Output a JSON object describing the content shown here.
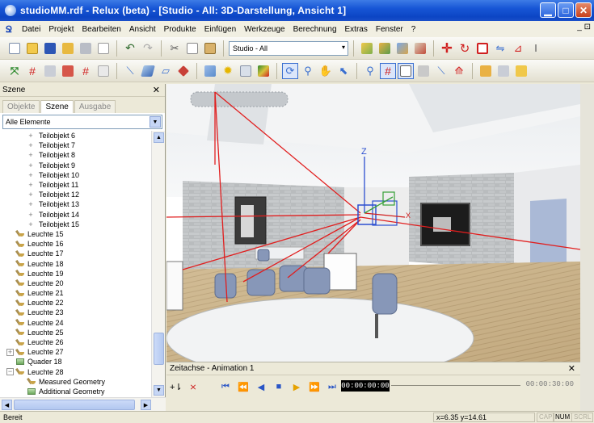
{
  "window": {
    "title": "studioMM.rdf - Relux (beta) - [Studio - All: 3D-Darstellung, Ansicht 1]",
    "buttons": [
      "minimize",
      "maximize",
      "close"
    ]
  },
  "menu": {
    "items": [
      "Datei",
      "Projekt",
      "Bearbeiten",
      "Ansicht",
      "Produkte",
      "Einfügen",
      "Werkzeuge",
      "Berechnung",
      "Extras",
      "Fenster",
      "?"
    ],
    "right": "_ ⊡"
  },
  "toolbar": {
    "combo_value": "Studio - All"
  },
  "scene_panel": {
    "title": "Szene",
    "tabs": [
      "Objekte",
      "Szene",
      "Ausgabe"
    ],
    "active_tab": "Szene",
    "filter_value": "Alle Elemente",
    "tree": [
      {
        "label": "Teilobjekt 6",
        "kind": "sub"
      },
      {
        "label": "Teilobjekt 7",
        "kind": "sub"
      },
      {
        "label": "Teilobjekt 8",
        "kind": "sub"
      },
      {
        "label": "Teilobjekt 9",
        "kind": "sub"
      },
      {
        "label": "Teilobjekt 10",
        "kind": "sub"
      },
      {
        "label": "Teilobjekt 11",
        "kind": "sub"
      },
      {
        "label": "Teilobjekt 12",
        "kind": "sub"
      },
      {
        "label": "Teilobjekt 13",
        "kind": "sub"
      },
      {
        "label": "Teilobjekt 14",
        "kind": "sub"
      },
      {
        "label": "Teilobjekt 15",
        "kind": "sub"
      },
      {
        "label": "Leuchte 15",
        "kind": "lamp"
      },
      {
        "label": "Leuchte 16",
        "kind": "lamp"
      },
      {
        "label": "Leuchte 17",
        "kind": "lamp"
      },
      {
        "label": "Leuchte 18",
        "kind": "lamp"
      },
      {
        "label": "Leuchte 19",
        "kind": "lamp"
      },
      {
        "label": "Leuchte 20",
        "kind": "lamp"
      },
      {
        "label": "Leuchte 21",
        "kind": "lamp"
      },
      {
        "label": "Leuchte 22",
        "kind": "lamp"
      },
      {
        "label": "Leuchte 23",
        "kind": "lamp"
      },
      {
        "label": "Leuchte 24",
        "kind": "lamp"
      },
      {
        "label": "Leuchte 25",
        "kind": "lamp"
      },
      {
        "label": "Leuchte 26",
        "kind": "lamp"
      },
      {
        "label": "Leuchte 27",
        "kind": "lampgroup"
      },
      {
        "label": "Quader 18",
        "kind": "box"
      },
      {
        "label": "Leuchte 28",
        "kind": "lampgroup-open"
      },
      {
        "label": "Measured Geometry",
        "kind": "child-lamp"
      },
      {
        "label": "Additional Geometry",
        "kind": "child-box"
      }
    ]
  },
  "timeline": {
    "title": "Zeitachse - Animation 1",
    "current_time": "00:00:00:00",
    "end_time": "00:00:30:00"
  },
  "statusbar": {
    "text": "Bereit",
    "coords": "x=6.35 y=14.61",
    "indicators": [
      "CAP",
      "NUM",
      "SCRL"
    ],
    "active_indicator": "NUM"
  },
  "viewport": {
    "axis_z": "Z",
    "axis_x": "X"
  }
}
